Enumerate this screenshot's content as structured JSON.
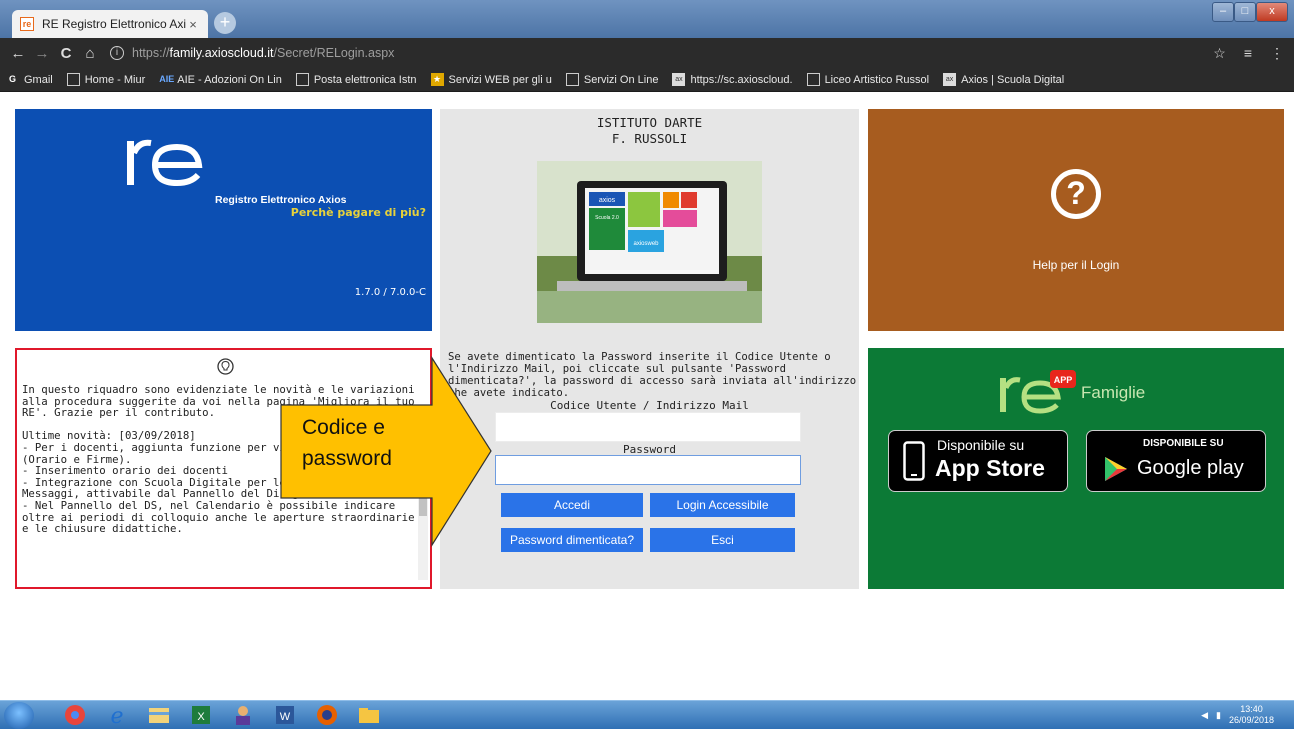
{
  "browser": {
    "tab_title": "RE Registro Elettronico Axios",
    "tab_close": "×",
    "new_tab": "+",
    "window_buttons": {
      "min": "–",
      "max": "□",
      "close": "x"
    },
    "nav": {
      "back": "←",
      "forward": "→",
      "reload": "C",
      "home": "⌂"
    },
    "url_prefix": "https://",
    "url_host": "family.axioscloud.it",
    "url_path": "/Secret/RELogin.aspx",
    "toolbar_right": [
      "☆",
      "≡",
      "⋮"
    ],
    "bookmarks": [
      {
        "label": "Gmail",
        "icon": "google-icon"
      },
      {
        "label": "Home - Miur",
        "icon": "page-icon"
      },
      {
        "label": "AIE - Adozioni On Lin",
        "icon": "aie-icon"
      },
      {
        "label": "Posta elettronica Istn",
        "icon": "page-icon"
      },
      {
        "label": "Servizi WEB per gli u",
        "icon": "star-icon"
      },
      {
        "label": "Servizi On Line",
        "icon": "page-icon"
      },
      {
        "label": "https://sc.axioscloud.",
        "icon": "axios-icon"
      },
      {
        "label": "Liceo Artistico Russol",
        "icon": "page-icon"
      },
      {
        "label": "Axios | Scuola Digital",
        "icon": "axios-icon"
      }
    ]
  },
  "brand_panel": {
    "logo": "re",
    "subtitle": "Registro Elettronico Axios",
    "slogan": "Perchè pagare di più?",
    "version": "1.7.0 / 7.0.0-C"
  },
  "login": {
    "school_line1": "ISTITUTO DARTE",
    "school_line2": "F. RUSSOLI",
    "screen_tile_axios": "axios",
    "screen_tile_scuola": "Scuola 2.0",
    "screen_tile_web": "axiosweb",
    "notice": "Se avete dimenticato la Password inserite il Codice Utente o l'Indirizzo Mail, poi cliccate sul pulsante 'Password dimenticata?', la password di accesso sarà inviata all'indirizzo che avete indicato.",
    "user_label": "Codice Utente / Indirizzo Mail",
    "user_value": "",
    "password_label": "Password",
    "password_value": "",
    "btn_accedi": "Accedi",
    "btn_accessibile": "Login Accessibile",
    "btn_forgot": "Password dimenticata?",
    "btn_exit": "Esci"
  },
  "help": {
    "symbol": "?",
    "label": "Help per il Login"
  },
  "app_panel": {
    "logo": "re",
    "badge": "APP",
    "title": "Famiglie",
    "appstore_small": "Disponibile su",
    "appstore_big": "App Store",
    "googleplay_small": "DISPONIBILE SU",
    "googleplay_big": "Google play"
  },
  "news": {
    "text": "In questo riquadro sono evidenziate le novità e le variazioni alla procedura suggerite da voi nella pagina 'Migliora il tuo RE'. Grazie per il contributo.\n\nUltime novità: [03/09/2018]\n- Per i docenti, aggiunta funzione per visualizzare il giorno (Orario e Firme).\n- Inserimento orario dei docenti\n- Integrazione con Scuola Digitale per le Notifiche e i Messaggi, attivabile dal Pannello del Dirigente.\n- Nel Pannello del DS, nel Calendario è possibile indicare oltre ai periodi di colloquio anche le aperture straordinarie e le chiusure didattiche."
  },
  "callout": {
    "line1": "Codice e",
    "line2": "password",
    "fill": "#ffc000"
  },
  "taskbar": {
    "apps": [
      "ie-icon",
      "chrome-icon",
      "ie-icon",
      "explorer-icon",
      "excel-icon",
      "user-icon",
      "word-icon",
      "firefox-icon",
      "folder-icon"
    ],
    "time": "13:40",
    "date": "26/09/2018"
  }
}
